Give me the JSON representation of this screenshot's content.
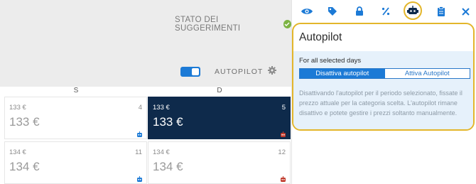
{
  "calendar": {
    "status_label": "STATO DEI SUGGERIMENTI",
    "autopilot_label": "AUTOPILOT",
    "days": [
      {
        "label": "S"
      },
      {
        "label": "D"
      }
    ],
    "rows": [
      [
        {
          "small": "133 €",
          "big": "133 €",
          "num": "4",
          "bot_color": "#1c7ad6",
          "selected": false
        },
        {
          "small": "133 €",
          "big": "133 €",
          "num": "5",
          "bot_color": "#c0392b",
          "selected": true
        }
      ],
      [
        {
          "small": "134 €",
          "big": "134 €",
          "num": "11",
          "bot_color": "#1c7ad6",
          "selected": false
        },
        {
          "small": "134 €",
          "big": "134 €",
          "num": "12",
          "bot_color": "#c0392b",
          "selected": false
        }
      ]
    ]
  },
  "tabs": [
    {
      "icon": "eye-icon"
    },
    {
      "icon": "tag-icon"
    },
    {
      "icon": "lock-icon"
    },
    {
      "icon": "percent-icon"
    },
    {
      "icon": "robot-icon",
      "active": true
    },
    {
      "icon": "clipboard-icon"
    },
    {
      "icon": "close-icon"
    }
  ],
  "panel": {
    "title": "Autopilot",
    "subtitle": "For all selected days",
    "options": [
      "Disattiva autopilot",
      "Attiva Autopilot"
    ],
    "selected_option": "Disattiva autopilot",
    "description": "Disattivando l'autopilot per il periodo selezionato, fissate il prezzo attuale per la categoria scelta. L'autopilot rimane disattivo e potete gestire i prezzi soltanto manualmente."
  },
  "colors": {
    "accent": "#1c7ad6",
    "highlight": "#e3b62b",
    "selected_cell": "#0e2a4b",
    "status_ok": "#7cb342"
  }
}
